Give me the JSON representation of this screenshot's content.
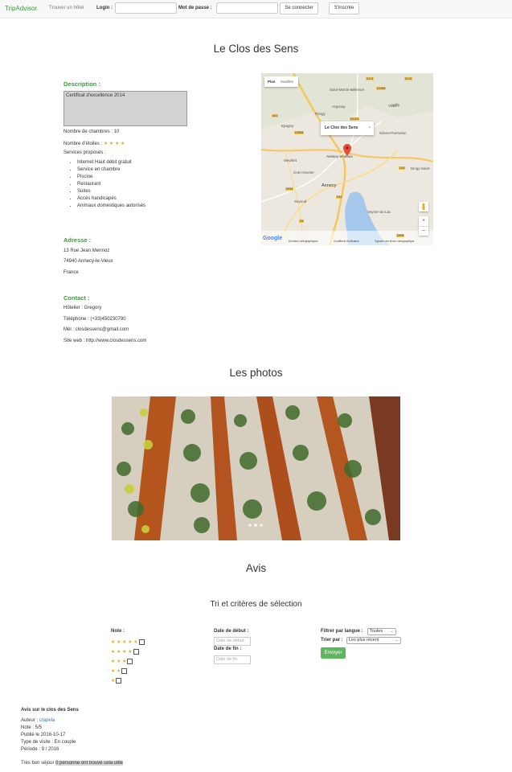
{
  "nav": {
    "brand": "TripAdvisor",
    "find_hotel": "Trouver un hôtel",
    "login_label": "Login :",
    "login_value": "",
    "password_label": "Mot de passe :",
    "password_value": "",
    "connect_button": "Se connecter",
    "signup_button": "S'inscrire"
  },
  "hotel": {
    "name": "Le Clos des Sens",
    "description_heading": "Description :",
    "description_text": "Certificat d'excellence 2014",
    "rooms": "Nombre de chambres : 10",
    "stars_label": "Nombre d'étoiles :",
    "stars_display": "★ ★ ★ ★",
    "star_count": 4,
    "services_label": "Services proposés :",
    "services": [
      "Internet Haut débit gratuit",
      "Service en chambre",
      "Piscine",
      "Restaurant",
      "Suites",
      "Accès handicapés",
      "Animaux domestiques autorisés"
    ],
    "address_heading": "Adresse :",
    "address": [
      "13 Rue Jean Mermoz",
      "74940 Annecy-le-Vieux",
      "France"
    ],
    "contact_heading": "Contact :",
    "contact": [
      "Hôtelier : Gregory",
      "Téléphone : (+33)450230790",
      "Mél : closdessens@gmail.com",
      "Site web : http://www.closdessens.com"
    ]
  },
  "map": {
    "type_plan": "Plan",
    "type_satellite": "Satellite",
    "popup_title": "Le Clos des Sens",
    "popup_close": "×",
    "google": "Google",
    "footer": [
      "Données cartographiques",
      "Conditions d'utilisation",
      "Signaler une erreur cartographique"
    ],
    "places": [
      "Saint-Martin-Bellevue",
      "Argonay",
      "Epagny",
      "Pringy",
      "Villaz",
      "Nâves-Parmelan",
      "Meythet",
      "Annecy-le-Vieux",
      "Cran-Gevrier",
      "Annecy",
      "Dingy-Saint-",
      "Seynod",
      "Veyrier-du-Lac",
      "Villy"
    ],
    "roads": [
      "D1508",
      "D174",
      "D175",
      "D1203",
      "D909",
      "D916",
      "D14",
      "D5",
      "D16",
      "D3508",
      "A41"
    ],
    "zoom_in": "+",
    "zoom_out": "−"
  },
  "photos": {
    "heading": "Les photos"
  },
  "reviews": {
    "heading": "Avis",
    "filter_heading": "Tri et critères de sélection",
    "note_label": "Note :",
    "star_rows": [
      "★ ★ ★ ★ ★",
      "★ ★ ★ ★",
      "★ ★ ★",
      "★ ★",
      "★"
    ],
    "date_start_label": "Date de début :",
    "date_start_placeholder": "Date de début",
    "date_end_label": "Date de fin :",
    "date_end_placeholder": "Date de fin",
    "lang_label": "Filtrer par langue :",
    "lang_value": "Toutes",
    "sort_label": "Trier par :",
    "sort_value": "Les plus récent",
    "send_button": "Envoyer"
  },
  "review": {
    "title": "Avis sur le clos des Sens",
    "author_label": "Auteur :",
    "author": "crapela",
    "note": "Note : 5/5",
    "published": "Publié le 2016-10-17",
    "visit_type": "Type de visite : En couple",
    "period": "Période : 9 / 2016",
    "text": "Très bon séjour",
    "helpful": "0 personne ont trouvé cela utile"
  },
  "colors": {
    "green": "#3c9c3c",
    "star": "#f0ad1a",
    "lake": "#a4c9ec"
  }
}
